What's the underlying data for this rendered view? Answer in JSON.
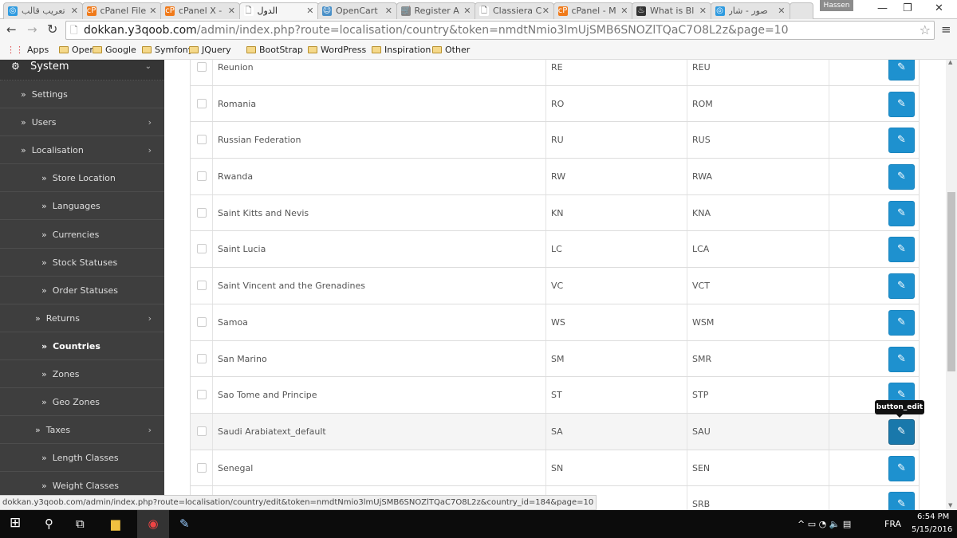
{
  "browser": {
    "tabs": [
      {
        "label": "تعريب قالب",
        "icon": "generic-blue-icon",
        "active": false
      },
      {
        "label": "cPanel File",
        "icon": "cpanel-icon",
        "active": false
      },
      {
        "label": "cPanel X -",
        "icon": "cpanel-icon",
        "active": false
      },
      {
        "label": "الدول",
        "icon": "page-icon",
        "active": true
      },
      {
        "label": "OpenCart",
        "icon": "opencart-icon",
        "active": false
      },
      {
        "label": "Register A",
        "icon": "cart-icon",
        "active": false
      },
      {
        "label": "Classiera C",
        "icon": "page-icon",
        "active": false
      },
      {
        "label": "cPanel - M",
        "icon": "cpanel-icon",
        "active": false
      },
      {
        "label": "What is Bl",
        "icon": "flame-icon",
        "active": false
      },
      {
        "label": "صور - شار",
        "icon": "generic-blue-icon",
        "active": false
      }
    ],
    "user": "Hassen",
    "url_host": "dokkan.y3qoob.com",
    "url_path": "/admin/index.php?route=localisation/country&token=nmdtNmio3lmUjSMB6SNOZlTQaC7O8L2z&page=10",
    "bookmarks": [
      "Apps",
      "Open",
      "Google",
      "Symfony",
      "JQuery",
      "BootStrap",
      "WordPress",
      "Inspiration",
      "Other"
    ]
  },
  "sidebar": {
    "header": "System",
    "items": [
      {
        "label": "Settings",
        "level": 1,
        "has_children": false
      },
      {
        "label": "Users",
        "level": 1,
        "has_children": true
      },
      {
        "label": "Localisation",
        "level": 1,
        "has_children": true
      },
      {
        "label": "Store Location",
        "level": 2,
        "has_children": false
      },
      {
        "label": "Languages",
        "level": 2,
        "has_children": false
      },
      {
        "label": "Currencies",
        "level": 2,
        "has_children": false
      },
      {
        "label": "Stock Statuses",
        "level": 2,
        "has_children": false
      },
      {
        "label": "Order Statuses",
        "level": 2,
        "has_children": false
      },
      {
        "label": "Returns",
        "level": 2,
        "has_children": true
      },
      {
        "label": "Countries",
        "level": 2,
        "has_children": false,
        "active": true
      },
      {
        "label": "Zones",
        "level": 2,
        "has_children": false
      },
      {
        "label": "Geo Zones",
        "level": 2,
        "has_children": false
      },
      {
        "label": "Taxes",
        "level": 2,
        "has_children": true
      },
      {
        "label": "Length Classes",
        "level": 2,
        "has_children": false
      },
      {
        "label": "Weight Classes",
        "level": 2,
        "has_children": false
      }
    ]
  },
  "countries": [
    {
      "name": "Reunion",
      "iso2": "RE",
      "iso3": "REU"
    },
    {
      "name": "Romania",
      "iso2": "RO",
      "iso3": "ROM"
    },
    {
      "name": "Russian Federation",
      "iso2": "RU",
      "iso3": "RUS"
    },
    {
      "name": "Rwanda",
      "iso2": "RW",
      "iso3": "RWA"
    },
    {
      "name": "Saint Kitts and Nevis",
      "iso2": "KN",
      "iso3": "KNA"
    },
    {
      "name": "Saint Lucia",
      "iso2": "LC",
      "iso3": "LCA"
    },
    {
      "name": "Saint Vincent and the Grenadines",
      "iso2": "VC",
      "iso3": "VCT"
    },
    {
      "name": "Samoa",
      "iso2": "WS",
      "iso3": "WSM"
    },
    {
      "name": "San Marino",
      "iso2": "SM",
      "iso3": "SMR"
    },
    {
      "name": "Sao Tome and Principe",
      "iso2": "ST",
      "iso3": "STP"
    },
    {
      "name": "Saudi Arabiatext_default",
      "iso2": "SA",
      "iso3": "SAU",
      "hover": true
    },
    {
      "name": "Senegal",
      "iso2": "SN",
      "iso3": "SEN"
    },
    {
      "name": "",
      "iso2": "",
      "iso3": "SRB"
    }
  ],
  "tooltip": "button_edit",
  "status_url": "dokkan.y3qoob.com/admin/index.php?route=localisation/country/edit&token=nmdtNmio3lmUjSMB6SNOZlTQaC7O8L2z&country_id=184&page=10",
  "taskbar": {
    "lang": "FRA",
    "time": "6:54 PM",
    "date": "5/15/2016"
  },
  "colors": {
    "accent": "#1e91cf",
    "accent_active": "#1978ab",
    "sidebar": "#3e3e3e"
  }
}
